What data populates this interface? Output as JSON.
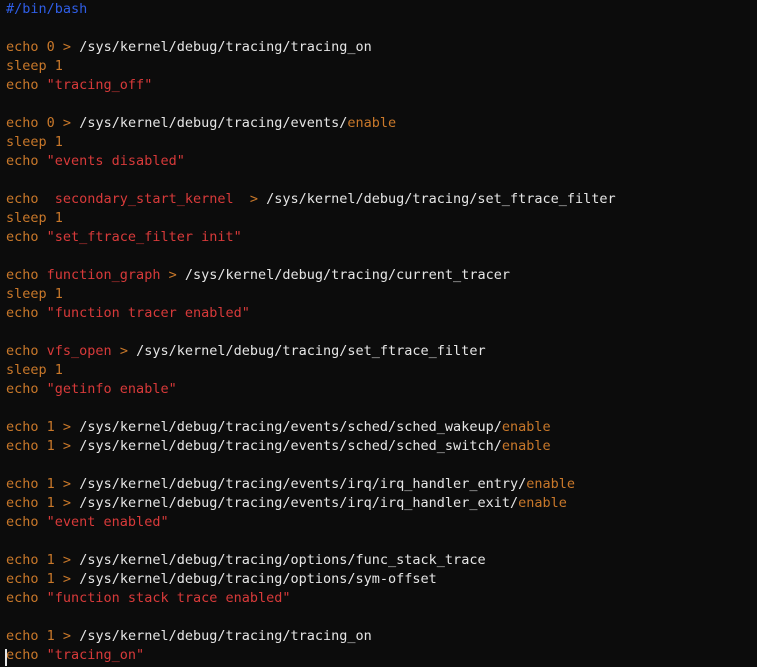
{
  "lines": [
    [
      {
        "t": "#/bin/bash",
        "c": "comment"
      }
    ],
    [],
    [
      {
        "t": "echo",
        "c": "kw"
      },
      {
        "t": " ",
        "c": "plain"
      },
      {
        "t": "0",
        "c": "num"
      },
      {
        "t": " > ",
        "c": "op"
      },
      {
        "t": "/sys/kernel/debug/tracing/tracing_on",
        "c": "path"
      }
    ],
    [
      {
        "t": "sleep",
        "c": "kw"
      },
      {
        "t": " ",
        "c": "plain"
      },
      {
        "t": "1",
        "c": "num"
      }
    ],
    [
      {
        "t": "echo",
        "c": "kw"
      },
      {
        "t": " ",
        "c": "plain"
      },
      {
        "t": "\"tracing_off\"",
        "c": "str"
      }
    ],
    [],
    [
      {
        "t": "echo",
        "c": "kw"
      },
      {
        "t": " ",
        "c": "plain"
      },
      {
        "t": "0",
        "c": "num"
      },
      {
        "t": " > ",
        "c": "op"
      },
      {
        "t": "/sys/kernel/debug/tracing/events/",
        "c": "path"
      },
      {
        "t": "enable",
        "c": "kw"
      }
    ],
    [
      {
        "t": "sleep",
        "c": "kw"
      },
      {
        "t": " ",
        "c": "plain"
      },
      {
        "t": "1",
        "c": "num"
      }
    ],
    [
      {
        "t": "echo",
        "c": "kw"
      },
      {
        "t": " ",
        "c": "plain"
      },
      {
        "t": "\"events disabled\"",
        "c": "str"
      }
    ],
    [],
    [
      {
        "t": "echo",
        "c": "kw"
      },
      {
        "t": "  ",
        "c": "plain"
      },
      {
        "t": "secondary_start_kernel",
        "c": "str"
      },
      {
        "t": "  > ",
        "c": "op"
      },
      {
        "t": "/sys/kernel/debug/tracing/set_ftrace_filter",
        "c": "path"
      }
    ],
    [
      {
        "t": "sleep",
        "c": "kw"
      },
      {
        "t": " ",
        "c": "plain"
      },
      {
        "t": "1",
        "c": "num"
      }
    ],
    [
      {
        "t": "echo",
        "c": "kw"
      },
      {
        "t": " ",
        "c": "plain"
      },
      {
        "t": "\"set_ftrace_filter init\"",
        "c": "str"
      }
    ],
    [],
    [
      {
        "t": "echo",
        "c": "kw"
      },
      {
        "t": " ",
        "c": "plain"
      },
      {
        "t": "function_graph",
        "c": "str"
      },
      {
        "t": " > ",
        "c": "op"
      },
      {
        "t": "/sys/kernel/debug/tracing/current_tracer",
        "c": "path"
      }
    ],
    [
      {
        "t": "sleep",
        "c": "kw"
      },
      {
        "t": " ",
        "c": "plain"
      },
      {
        "t": "1",
        "c": "num"
      }
    ],
    [
      {
        "t": "echo",
        "c": "kw"
      },
      {
        "t": " ",
        "c": "plain"
      },
      {
        "t": "\"function tracer enabled\"",
        "c": "str"
      }
    ],
    [],
    [
      {
        "t": "echo",
        "c": "kw"
      },
      {
        "t": " ",
        "c": "plain"
      },
      {
        "t": "vfs_open",
        "c": "str"
      },
      {
        "t": " > ",
        "c": "op"
      },
      {
        "t": "/sys/kernel/debug/tracing/set_ftrace_filter",
        "c": "path"
      }
    ],
    [
      {
        "t": "sleep",
        "c": "kw"
      },
      {
        "t": " ",
        "c": "plain"
      },
      {
        "t": "1",
        "c": "num"
      }
    ],
    [
      {
        "t": "echo",
        "c": "kw"
      },
      {
        "t": " ",
        "c": "plain"
      },
      {
        "t": "\"getinfo enable\"",
        "c": "str"
      }
    ],
    [],
    [
      {
        "t": "echo",
        "c": "kw"
      },
      {
        "t": " ",
        "c": "plain"
      },
      {
        "t": "1",
        "c": "num"
      },
      {
        "t": " > ",
        "c": "op"
      },
      {
        "t": "/sys/kernel/debug/tracing/events/sched/sched_wakeup/",
        "c": "path"
      },
      {
        "t": "enable",
        "c": "kw"
      }
    ],
    [
      {
        "t": "echo",
        "c": "kw"
      },
      {
        "t": " ",
        "c": "plain"
      },
      {
        "t": "1",
        "c": "num"
      },
      {
        "t": " > ",
        "c": "op"
      },
      {
        "t": "/sys/kernel/debug/tracing/events/sched/sched_switch/",
        "c": "path"
      },
      {
        "t": "enable",
        "c": "kw"
      }
    ],
    [],
    [
      {
        "t": "echo",
        "c": "kw"
      },
      {
        "t": " ",
        "c": "plain"
      },
      {
        "t": "1",
        "c": "num"
      },
      {
        "t": " > ",
        "c": "op"
      },
      {
        "t": "/sys/kernel/debug/tracing/events/irq/irq_handler_entry/",
        "c": "path"
      },
      {
        "t": "enable",
        "c": "kw"
      }
    ],
    [
      {
        "t": "echo",
        "c": "kw"
      },
      {
        "t": " ",
        "c": "plain"
      },
      {
        "t": "1",
        "c": "num"
      },
      {
        "t": " > ",
        "c": "op"
      },
      {
        "t": "/sys/kernel/debug/tracing/events/irq/irq_handler_exit/",
        "c": "path"
      },
      {
        "t": "enable",
        "c": "kw"
      }
    ],
    [
      {
        "t": "echo",
        "c": "kw"
      },
      {
        "t": " ",
        "c": "plain"
      },
      {
        "t": "\"event enabled\"",
        "c": "str"
      }
    ],
    [],
    [
      {
        "t": "echo",
        "c": "kw"
      },
      {
        "t": " ",
        "c": "plain"
      },
      {
        "t": "1",
        "c": "num"
      },
      {
        "t": " > ",
        "c": "op"
      },
      {
        "t": "/sys/kernel/debug/tracing/options/func_stack_trace",
        "c": "path"
      }
    ],
    [
      {
        "t": "echo",
        "c": "kw"
      },
      {
        "t": " ",
        "c": "plain"
      },
      {
        "t": "1",
        "c": "num"
      },
      {
        "t": " > ",
        "c": "op"
      },
      {
        "t": "/sys/kernel/debug/tracing/options/sym-offset",
        "c": "path"
      }
    ],
    [
      {
        "t": "echo",
        "c": "kw"
      },
      {
        "t": " ",
        "c": "plain"
      },
      {
        "t": "\"function stack trace enabled\"",
        "c": "str"
      }
    ],
    [],
    [
      {
        "t": "echo",
        "c": "kw"
      },
      {
        "t": " ",
        "c": "plain"
      },
      {
        "t": "1",
        "c": "num"
      },
      {
        "t": " > ",
        "c": "op"
      },
      {
        "t": "/sys/kernel/debug/tracing/tracing_on",
        "c": "path"
      }
    ],
    [
      {
        "t": "echo",
        "c": "kw"
      },
      {
        "t": " ",
        "c": "plain"
      },
      {
        "t": "\"tracing_on\"",
        "c": "str"
      }
    ]
  ],
  "colors": {
    "background": "#0c0c0c",
    "comment": "#2f5ee6",
    "keyword": "#c9782a",
    "string": "#d83a3a",
    "path": "#e6e6e6"
  }
}
